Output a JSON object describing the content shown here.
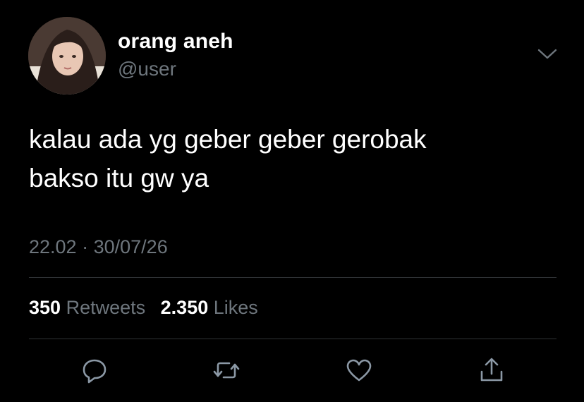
{
  "tweet": {
    "display_name": "orang aneh",
    "handle": "@user",
    "body_line1": "kalau ada yg geber geber gerobak",
    "body_line2": "bakso itu gw ya",
    "time": "22.02",
    "separator": "·",
    "date": "30/07/26",
    "retweet_count": "350",
    "retweet_label": "Retweets",
    "like_count": "2.350",
    "like_label": "Likes"
  },
  "icons": {
    "menu": "chevron-down-icon",
    "reply": "reply-icon",
    "retweet": "retweet-icon",
    "like": "heart-icon",
    "share": "share-icon"
  },
  "colors": {
    "background": "#000000",
    "primary_text": "#ffffff",
    "secondary_text": "#6e767d",
    "divider": "#2f3336"
  }
}
